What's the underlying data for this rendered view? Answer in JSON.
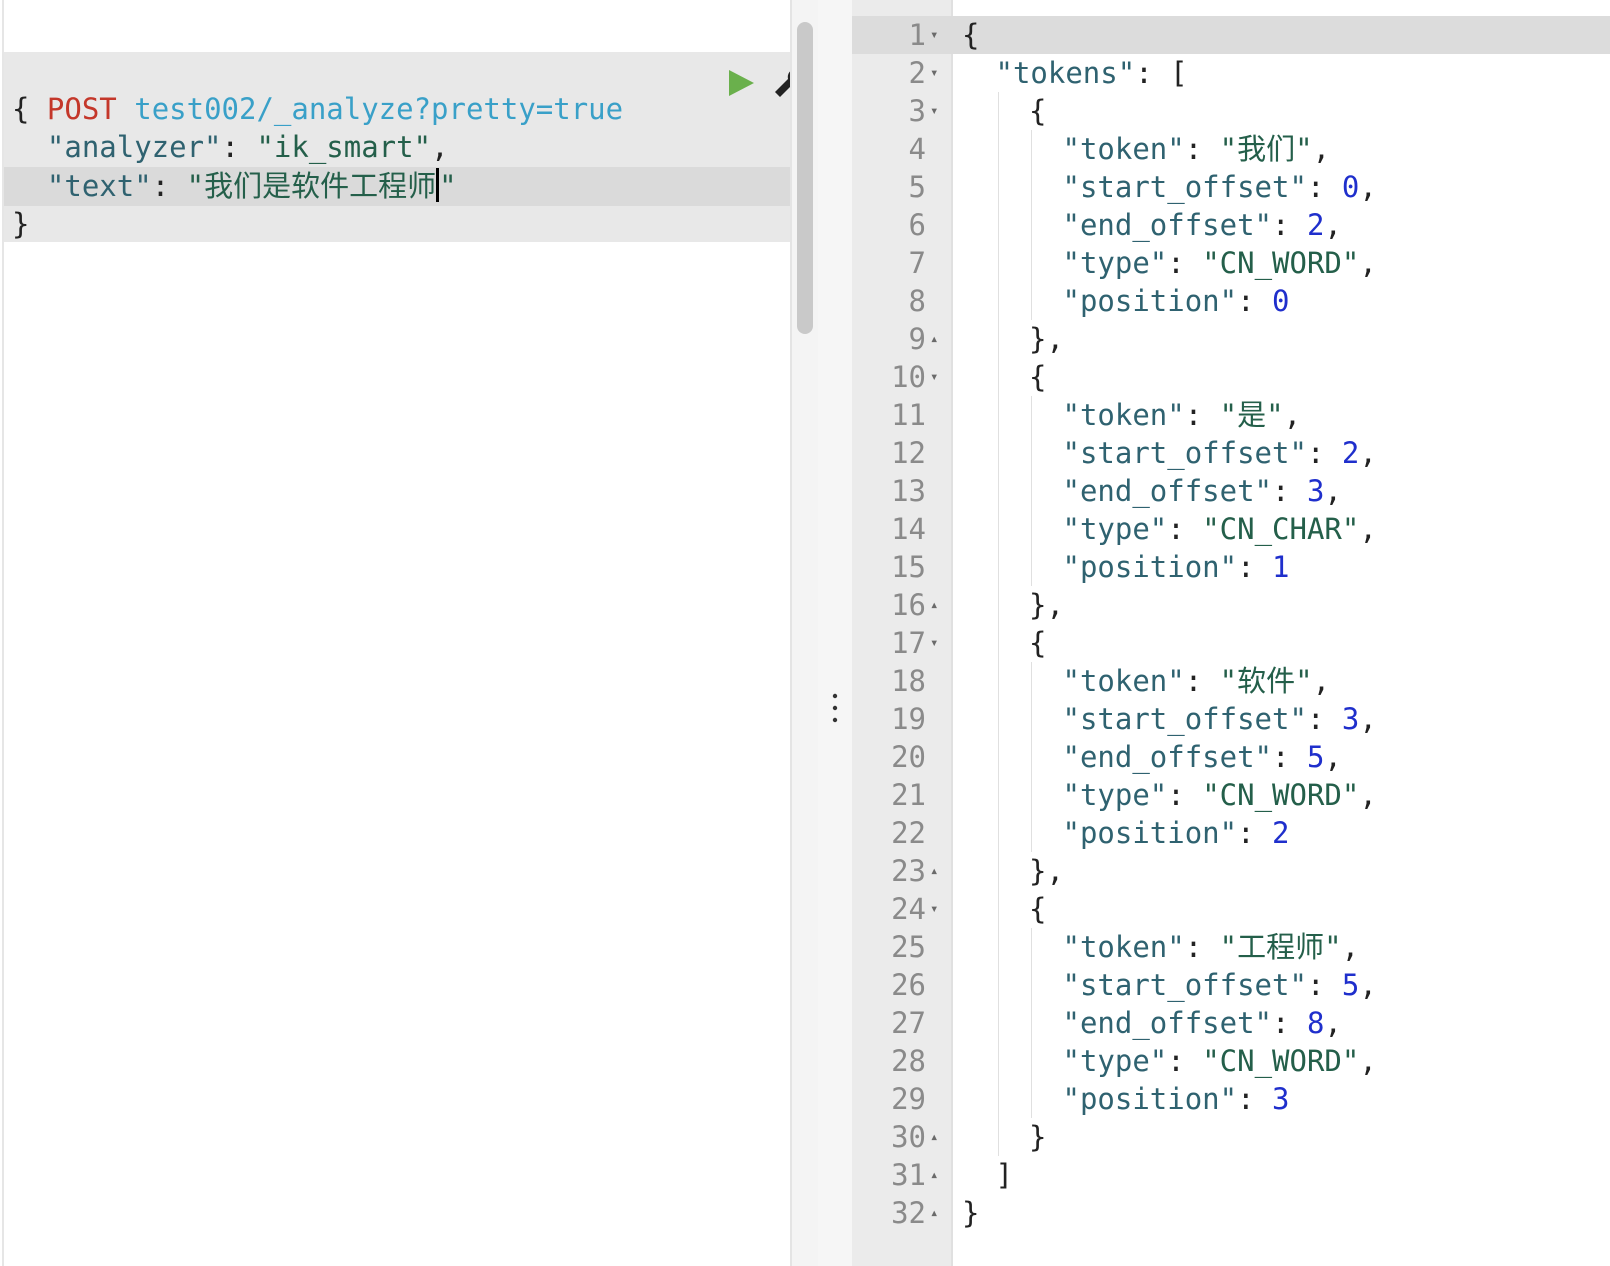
{
  "request_editor": {
    "method": "POST",
    "url": "test002/_analyze?pretty=true",
    "lines": [
      {
        "indent": "",
        "open": "{"
      },
      {
        "indent": "  ",
        "key": "\"analyzer\"",
        "colon": ": ",
        "value": "\"ik_smart\"",
        "tail": ","
      },
      {
        "indent": "  ",
        "key": "\"text\"",
        "colon": ": ",
        "value": "\"我们是软件工程师",
        "tail": "\""
      },
      {
        "indent": "",
        "close": "}"
      }
    ],
    "run_icon": "play-icon",
    "settings_icon": "wrench-icon"
  },
  "response_viewer": {
    "line_numbers": [
      "1",
      "2",
      "3",
      "4",
      "5",
      "6",
      "7",
      "8",
      "9",
      "10",
      "11",
      "12",
      "13",
      "14",
      "15",
      "16",
      "17",
      "18",
      "19",
      "20",
      "21",
      "22",
      "23",
      "24",
      "25",
      "26",
      "27",
      "28",
      "29",
      "30",
      "31",
      "32"
    ],
    "fold_markers": {
      "1": "▾",
      "2": "▾",
      "3": "▾",
      "9": "▴",
      "10": "▾",
      "16": "▴",
      "17": "▾",
      "23": "▴",
      "24": "▾",
      "30": "▴",
      "31": "▴",
      "32": "▴"
    },
    "lines": [
      [
        [
          "p",
          "{"
        ]
      ],
      [
        [
          "k",
          "\"tokens\""
        ],
        [
          "p",
          ": ["
        ]
      ],
      [
        [
          "p",
          "{"
        ]
      ],
      [
        [
          "k",
          "\"token\""
        ],
        [
          "p",
          ": "
        ],
        [
          "s",
          "\"我们\""
        ],
        [
          "p",
          ","
        ]
      ],
      [
        [
          "k",
          "\"start_offset\""
        ],
        [
          "p",
          ": "
        ],
        [
          "n",
          "0"
        ],
        [
          "p",
          ","
        ]
      ],
      [
        [
          "k",
          "\"end_offset\""
        ],
        [
          "p",
          ": "
        ],
        [
          "n",
          "2"
        ],
        [
          "p",
          ","
        ]
      ],
      [
        [
          "k",
          "\"type\""
        ],
        [
          "p",
          ": "
        ],
        [
          "s",
          "\"CN_WORD\""
        ],
        [
          "p",
          ","
        ]
      ],
      [
        [
          "k",
          "\"position\""
        ],
        [
          "p",
          ": "
        ],
        [
          "n",
          "0"
        ]
      ],
      [
        [
          "p",
          "},"
        ]
      ],
      [
        [
          "p",
          "{"
        ]
      ],
      [
        [
          "k",
          "\"token\""
        ],
        [
          "p",
          ": "
        ],
        [
          "s",
          "\"是\""
        ],
        [
          "p",
          ","
        ]
      ],
      [
        [
          "k",
          "\"start_offset\""
        ],
        [
          "p",
          ": "
        ],
        [
          "n",
          "2"
        ],
        [
          "p",
          ","
        ]
      ],
      [
        [
          "k",
          "\"end_offset\""
        ],
        [
          "p",
          ": "
        ],
        [
          "n",
          "3"
        ],
        [
          "p",
          ","
        ]
      ],
      [
        [
          "k",
          "\"type\""
        ],
        [
          "p",
          ": "
        ],
        [
          "s",
          "\"CN_CHAR\""
        ],
        [
          "p",
          ","
        ]
      ],
      [
        [
          "k",
          "\"position\""
        ],
        [
          "p",
          ": "
        ],
        [
          "n",
          "1"
        ]
      ],
      [
        [
          "p",
          "},"
        ]
      ],
      [
        [
          "p",
          "{"
        ]
      ],
      [
        [
          "k",
          "\"token\""
        ],
        [
          "p",
          ": "
        ],
        [
          "s",
          "\"软件\""
        ],
        [
          "p",
          ","
        ]
      ],
      [
        [
          "k",
          "\"start_offset\""
        ],
        [
          "p",
          ": "
        ],
        [
          "n",
          "3"
        ],
        [
          "p",
          ","
        ]
      ],
      [
        [
          "k",
          "\"end_offset\""
        ],
        [
          "p",
          ": "
        ],
        [
          "n",
          "5"
        ],
        [
          "p",
          ","
        ]
      ],
      [
        [
          "k",
          "\"type\""
        ],
        [
          "p",
          ": "
        ],
        [
          "s",
          "\"CN_WORD\""
        ],
        [
          "p",
          ","
        ]
      ],
      [
        [
          "k",
          "\"position\""
        ],
        [
          "p",
          ": "
        ],
        [
          "n",
          "2"
        ]
      ],
      [
        [
          "p",
          "},"
        ]
      ],
      [
        [
          "p",
          "{"
        ]
      ],
      [
        [
          "k",
          "\"token\""
        ],
        [
          "p",
          ": "
        ],
        [
          "s",
          "\"工程师\""
        ],
        [
          "p",
          ","
        ]
      ],
      [
        [
          "k",
          "\"start_offset\""
        ],
        [
          "p",
          ": "
        ],
        [
          "n",
          "5"
        ],
        [
          "p",
          ","
        ]
      ],
      [
        [
          "k",
          "\"end_offset\""
        ],
        [
          "p",
          ": "
        ],
        [
          "n",
          "8"
        ],
        [
          "p",
          ","
        ]
      ],
      [
        [
          "k",
          "\"type\""
        ],
        [
          "p",
          ": "
        ],
        [
          "s",
          "\"CN_WORD\""
        ],
        [
          "p",
          ","
        ]
      ],
      [
        [
          "k",
          "\"position\""
        ],
        [
          "p",
          ": "
        ],
        [
          "n",
          "3"
        ]
      ],
      [
        [
          "p",
          "}"
        ]
      ],
      [
        [
          "p",
          "]"
        ]
      ],
      [
        [
          "p",
          "}"
        ]
      ]
    ]
  },
  "colors": {
    "method": "#c4372a",
    "url": "#39a0c8",
    "key": "#2f6270",
    "string": "#245f4a",
    "number": "#1f2fcc",
    "run": "#6ab04c"
  }
}
